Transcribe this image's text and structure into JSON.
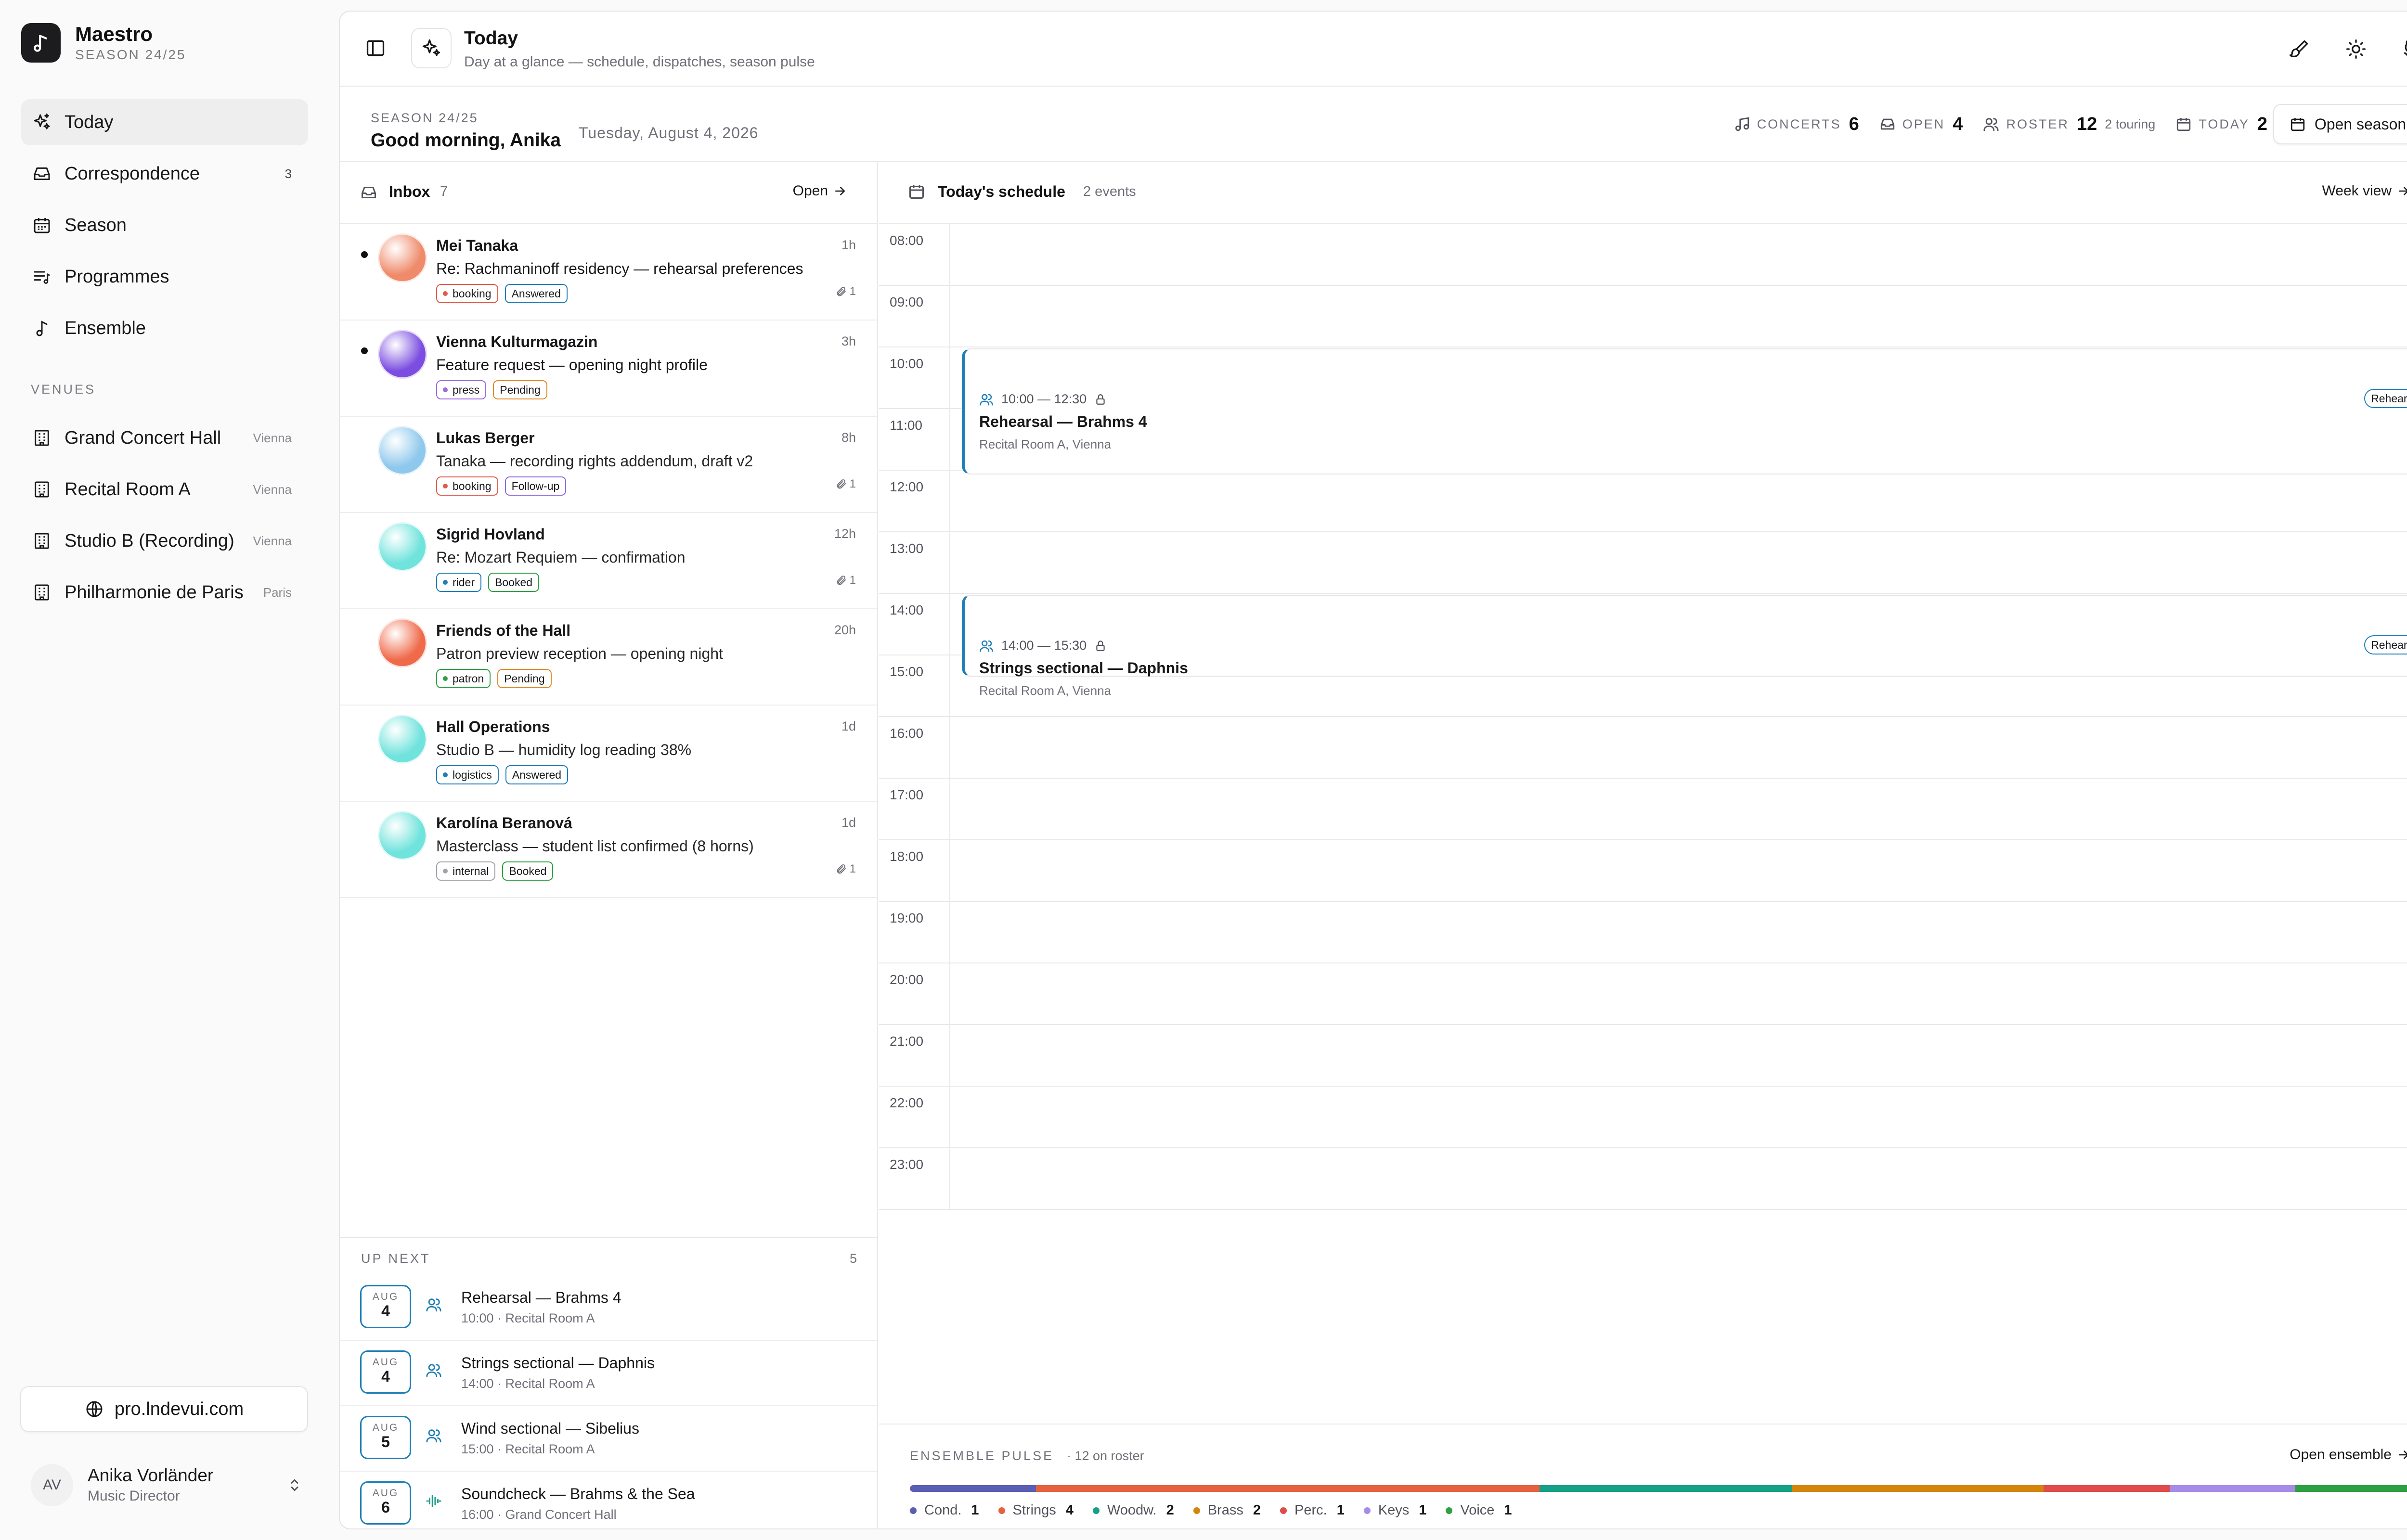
{
  "brand": {
    "name": "Maestro",
    "season": "SEASON 24/25"
  },
  "nav": [
    {
      "label": "Today",
      "icon": "sparkle-icon",
      "badge": ""
    },
    {
      "label": "Correspondence",
      "icon": "inbox-icon",
      "badge": "3"
    },
    {
      "label": "Season",
      "icon": "calendar-icon",
      "badge": ""
    },
    {
      "label": "Programmes",
      "icon": "playlist-icon",
      "badge": ""
    },
    {
      "label": "Ensemble",
      "icon": "music-note-icon",
      "badge": ""
    }
  ],
  "venues_heading": "VENUES",
  "venues": [
    {
      "label": "Grand Concert Hall",
      "city": "Vienna"
    },
    {
      "label": "Recital Room A",
      "city": "Vienna"
    },
    {
      "label": "Studio B (Recording)",
      "city": "Vienna"
    },
    {
      "label": "Philharmonie de Paris",
      "city": "Paris"
    }
  ],
  "site": "pro.lndevui.com",
  "user": {
    "initials": "AV",
    "name": "Anika Vorländer",
    "role": "Music Director"
  },
  "topbar": {
    "title": "Today",
    "subtitle": "Day at a glance — schedule, dispatches, season pulse"
  },
  "greet": {
    "season": "SEASON 24/25",
    "greeting": "Good morning, Anika",
    "date": "Tuesday, August 4, 2026"
  },
  "stats": [
    {
      "label": "CONCERTS",
      "value": "6",
      "extra": ""
    },
    {
      "label": "OPEN",
      "value": "4",
      "extra": ""
    },
    {
      "label": "ROSTER",
      "value": "12",
      "extra": "2 touring"
    },
    {
      "label": "TODAY",
      "value": "2",
      "extra": ""
    }
  ],
  "open_season": "Open season",
  "inbox": {
    "title": "Inbox",
    "count": "7",
    "open": "Open",
    "messages": [
      {
        "from": "Mei Tanaka",
        "time": "1h",
        "subject": "Re: Rachmaninoff residency — rehearsal preferences",
        "tag": "booking",
        "status": "Answered",
        "attach": "1",
        "unread": true,
        "avatar": "#ef8a6a"
      },
      {
        "from": "Vienna Kulturmagazin",
        "time": "3h",
        "subject": "Feature request — opening night profile",
        "tag": "press",
        "status": "Pending",
        "attach": "",
        "unread": true,
        "avatar": "#7b4de0"
      },
      {
        "from": "Lukas Berger",
        "time": "8h",
        "subject": "Tanaka — recording rights addendum, draft v2",
        "tag": "booking",
        "status": "Follow-up",
        "attach": "1",
        "unread": false,
        "avatar": "#8ec8ec"
      },
      {
        "from": "Sigrid Hovland",
        "time": "12h",
        "subject": "Re: Mozart Requiem — confirmation",
        "tag": "rider",
        "status": "Booked",
        "attach": "1",
        "unread": false,
        "avatar": "#6fe3dc"
      },
      {
        "from": "Friends of the Hall",
        "time": "20h",
        "subject": "Patron preview reception — opening night",
        "tag": "patron",
        "status": "Pending",
        "attach": "",
        "unread": false,
        "avatar": "#ef6a4a"
      },
      {
        "from": "Hall Operations",
        "time": "1d",
        "subject": "Studio B — humidity log reading 38%",
        "tag": "logistics",
        "status": "Answered",
        "attach": "",
        "unread": false,
        "avatar": "#6fe3dc"
      },
      {
        "from": "Karolína Beranová",
        "time": "1d",
        "subject": "Masterclass — student list confirmed (8 horns)",
        "tag": "internal",
        "status": "Booked",
        "attach": "1",
        "unread": false,
        "avatar": "#6fe3dc"
      }
    ]
  },
  "upnext": {
    "title": "UP NEXT",
    "count": "5",
    "events": [
      {
        "month": "AUG",
        "day": "4",
        "title": "Rehearsal — Brahms 4",
        "sub": "10:00 · Recital Room A",
        "icon": "users-icon"
      },
      {
        "month": "AUG",
        "day": "4",
        "title": "Strings sectional — Daphnis",
        "sub": "14:00 · Recital Room A",
        "icon": "users-icon"
      },
      {
        "month": "AUG",
        "day": "5",
        "title": "Wind sectional — Sibelius",
        "sub": "15:00 · Recital Room A",
        "icon": "users-icon"
      },
      {
        "month": "AUG",
        "day": "6",
        "title": "Soundcheck — Brahms & the Sea",
        "sub": "16:00 · Grand Concert Hall",
        "icon": "waveform-icon"
      }
    ]
  },
  "schedule": {
    "title": "Today's schedule",
    "count": "2 events",
    "week": "Week view",
    "hours": [
      "08:00",
      "09:00",
      "10:00",
      "11:00",
      "12:00",
      "13:00",
      "14:00",
      "15:00",
      "16:00",
      "17:00",
      "18:00",
      "19:00",
      "20:00",
      "21:00",
      "22:00",
      "23:00"
    ],
    "events": [
      {
        "time": "10:00 — 12:30",
        "title": "Rehearsal — Brahms 4",
        "location": "Recital Room A, Vienna",
        "type": "Rehearsal",
        "start": 10,
        "end": 12.5
      },
      {
        "time": "14:00 — 15:30",
        "title": "Strings sectional — Daphnis",
        "location": "Recital Room A, Vienna",
        "type": "Rehearsal",
        "start": 14,
        "end": 15.5
      }
    ]
  },
  "pulse": {
    "title": "ENSEMBLE PULSE",
    "sub": "· 12 on roster",
    "open": "Open ensemble",
    "groups": [
      {
        "name": "Cond.",
        "count": 1,
        "color": "#5b5fb4"
      },
      {
        "name": "Strings",
        "count": 4,
        "color": "#e4623f"
      },
      {
        "name": "Woodw.",
        "count": 2,
        "color": "#16a085"
      },
      {
        "name": "Brass",
        "count": 2,
        "color": "#d4860b"
      },
      {
        "name": "Perc.",
        "count": 1,
        "color": "#e04b4b"
      },
      {
        "name": "Keys",
        "count": 1,
        "color": "#a78be8"
      },
      {
        "name": "Voice",
        "count": 1,
        "color": "#2ea043"
      }
    ]
  },
  "tag_colors": {
    "booking": "#e05a4a",
    "press": "#9b6be0",
    "rider": "#1e7fb6",
    "patron": "#2ea043",
    "logistics": "#1e7fb6",
    "internal": "#a1a1aa",
    "Answered": "#1e7fb6",
    "Pending": "#e08a2a",
    "Follow-up": "#8b6be0",
    "Booked": "#2ea043"
  }
}
